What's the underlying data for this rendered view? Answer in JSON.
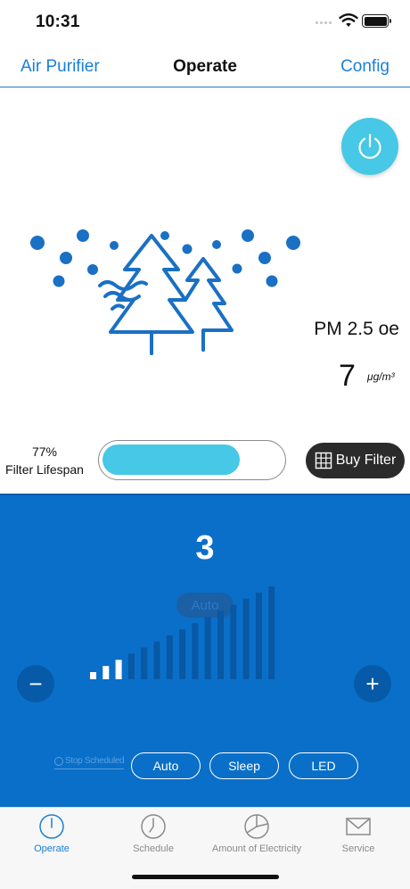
{
  "status": {
    "time": "10:31"
  },
  "nav": {
    "back_label": "Air Purifier",
    "title": "Operate",
    "config_label": "Config"
  },
  "air": {
    "pm_label": "PM 2.5 oe",
    "pm_value": "7",
    "pm_unit": "μg/m³"
  },
  "filter": {
    "percent_text": "77%",
    "percent": 77,
    "label": "Filter Lifespan",
    "buy_label": "Buy Filter"
  },
  "control": {
    "speed_level": "3",
    "auto_badge": "Auto",
    "minus_label": "−",
    "plus_label": "+",
    "levels_total": 15,
    "levels_active": 3,
    "stop_scheduled_label": "Stop Scheduled",
    "modes": [
      "Auto",
      "Sleep",
      "LED"
    ]
  },
  "tabs": [
    {
      "label": "Operate",
      "icon": "power-icon",
      "active": true
    },
    {
      "label": "Schedule",
      "icon": "clock-icon",
      "active": false
    },
    {
      "label": "Amount of Electricity",
      "icon": "pie-chart-icon",
      "active": false
    },
    {
      "label": "Service",
      "icon": "mail-icon",
      "active": false
    }
  ],
  "colors": {
    "accent": "#1a7fd8",
    "cyan": "#46c8e6",
    "panel": "#0a6fc8",
    "dark_button": "#2b2b2b"
  }
}
